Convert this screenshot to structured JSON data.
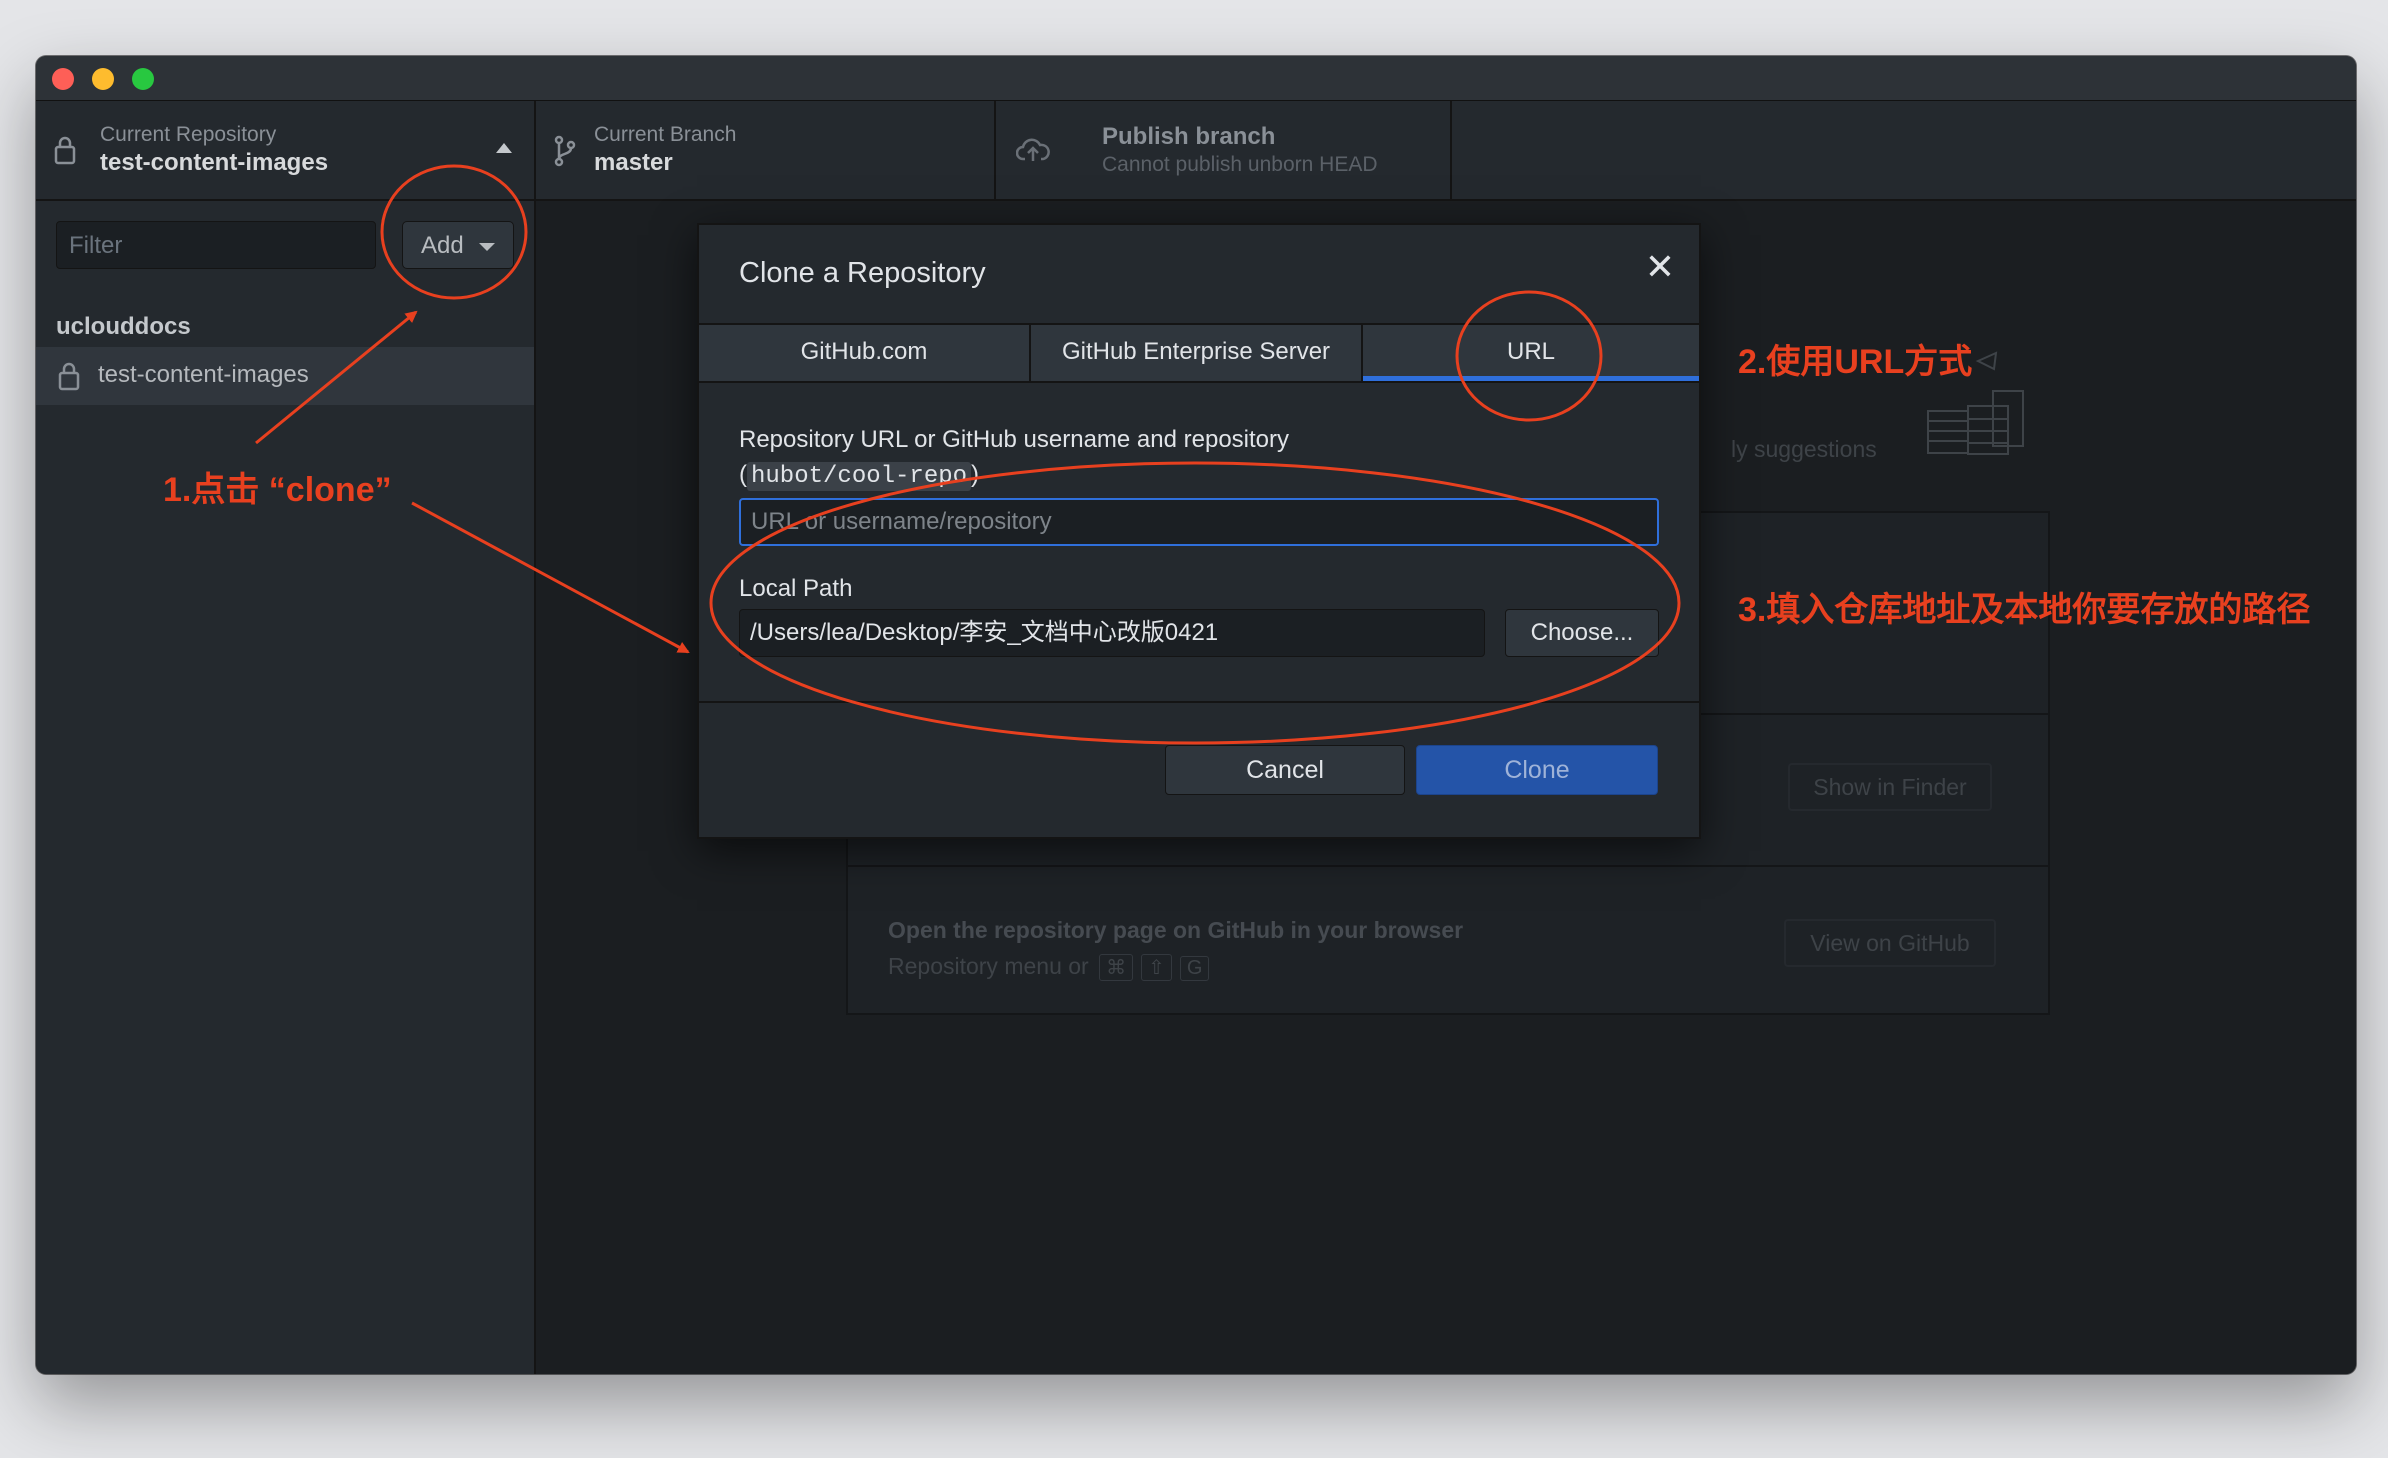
{
  "toolbar": {
    "repo_label": "Current Repository",
    "repo_name": "test-content-images",
    "branch_label": "Current Branch",
    "branch_name": "master",
    "publish_title": "Publish branch",
    "publish_sub": "Cannot publish unborn HEAD"
  },
  "sidebar": {
    "filter_placeholder": "Filter",
    "add_label": "Add",
    "group": "uclouddocs",
    "repo_item": "test-content-images"
  },
  "background": {
    "suggestions_partial": "ly suggestions",
    "finder_button": "Show in Finder",
    "github_row_title": "Open the repository page on GitHub in your browser",
    "github_row_sub": "Repository menu or",
    "shortcut_keys": [
      "⌘",
      "⇧",
      "G"
    ],
    "github_button": "View on GitHub"
  },
  "dialog": {
    "title": "Clone a Repository",
    "close": "✕",
    "tabs": [
      "GitHub.com",
      "GitHub Enterprise Server",
      "URL"
    ],
    "active_tab": "URL",
    "url_label": "Repository URL or GitHub username and repository",
    "url_hint_open": "(",
    "url_hint_code": "hubot/cool-repo",
    "url_hint_close": ")",
    "url_placeholder": "URL or username/repository",
    "local_path_label": "Local Path",
    "local_path_value": "/Users/lea/Desktop/李安_文档中心改版0421",
    "choose_label": "Choose...",
    "cancel_label": "Cancel",
    "clone_label": "Clone"
  },
  "annotations": {
    "step1": "1.点击 “clone”",
    "step2": "2.使用URL方式",
    "step3": "3.填入仓库地址及本地你要存放的路径",
    "color": "#e8401f"
  },
  "colors": {
    "window_bg": "#24292e",
    "accent_blue": "#2f6fdb",
    "clone_button": "#2454a8"
  }
}
